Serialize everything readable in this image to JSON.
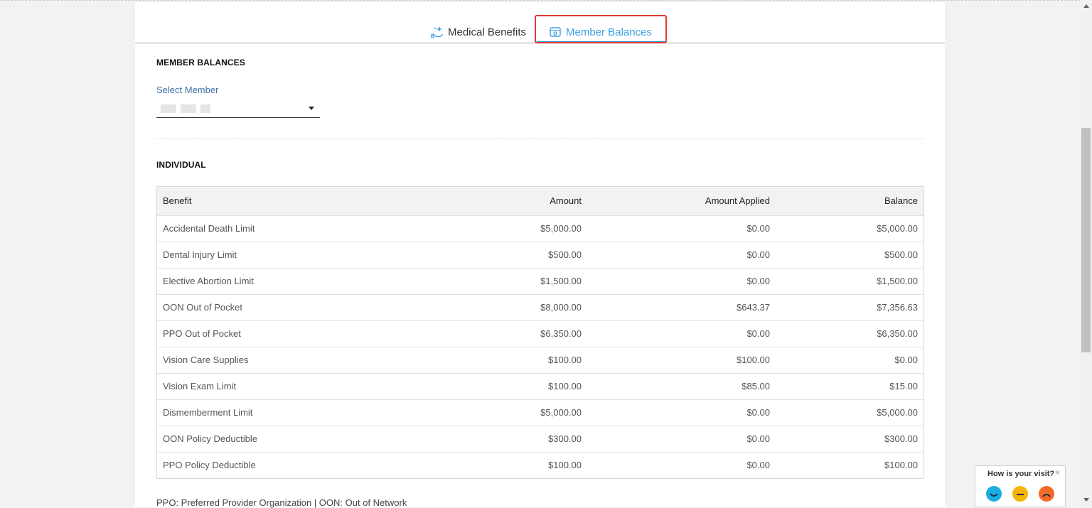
{
  "tabs": [
    {
      "label": "Medical Benefits",
      "icon": "medical-hand-icon",
      "active": false
    },
    {
      "label": "Member Balances",
      "icon": "wallet-icon",
      "active": true
    }
  ],
  "member_balances": {
    "title": "MEMBER BALANCES",
    "select_label": "Select Member",
    "selected_member": ""
  },
  "individual": {
    "title": "INDIVIDUAL",
    "columns": [
      "Benefit",
      "Amount",
      "Amount Applied",
      "Balance"
    ],
    "rows": [
      [
        "Accidental Death Limit",
        "$5,000.00",
        "$0.00",
        "$5,000.00"
      ],
      [
        "Dental Injury Limit",
        "$500.00",
        "$0.00",
        "$500.00"
      ],
      [
        "Elective Abortion Limit",
        "$1,500.00",
        "$0.00",
        "$1,500.00"
      ],
      [
        "OON Out of Pocket",
        "$8,000.00",
        "$643.37",
        "$7,356.63"
      ],
      [
        "PPO Out of Pocket",
        "$6,350.00",
        "$0.00",
        "$6,350.00"
      ],
      [
        "Vision Care Supplies",
        "$100.00",
        "$100.00",
        "$0.00"
      ],
      [
        "Vision Exam Limit",
        "$100.00",
        "$85.00",
        "$15.00"
      ],
      [
        "Dismemberment Limit",
        "$5,000.00",
        "$0.00",
        "$5,000.00"
      ],
      [
        "OON Policy Deductible",
        "$300.00",
        "$0.00",
        "$300.00"
      ],
      [
        "PPO Policy Deductible",
        "$100.00",
        "$0.00",
        "$100.00"
      ]
    ]
  },
  "footnote": "PPO: Preferred Provider Organization | OON: Out of Network",
  "feedback": {
    "question": "How is your visit?",
    "close": "×",
    "faces": [
      "happy-face-icon",
      "neutral-face-icon",
      "sad-face-icon"
    ]
  },
  "colors": {
    "accent": "#3aa0e0",
    "highlight": "#e53935",
    "happy": "#1aaee0",
    "neutral": "#f4b400",
    "sad": "#f26b28"
  }
}
